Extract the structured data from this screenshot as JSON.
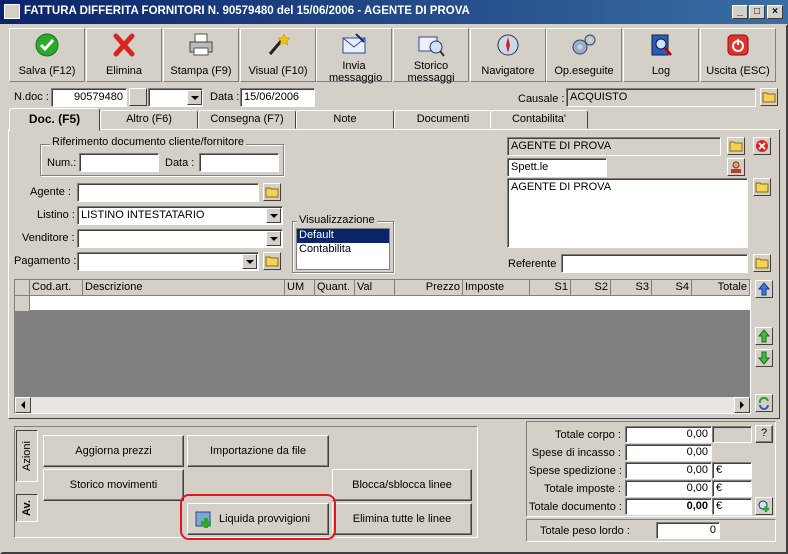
{
  "window": {
    "title": "FATTURA DIFFERITA FORNITORI N. 90579480  del 15/06/2006  - AGENTE DI PROVA",
    "minimize": "_",
    "maximize": "□",
    "close": "×"
  },
  "toolbar": [
    {
      "label": "Salva (F12)",
      "icon": "check-icon"
    },
    {
      "label": "Elimina",
      "icon": "delete-x-icon"
    },
    {
      "label": "Stampa (F9)",
      "icon": "printer-icon"
    },
    {
      "label": "Visual (F10)",
      "icon": "magic-wand-icon"
    },
    {
      "label": "Invia messaggio",
      "icon": "send-mail-icon"
    },
    {
      "label": "Storico messaggi",
      "icon": "mail-history-icon"
    },
    {
      "label": "Navigatore",
      "icon": "compass-icon"
    },
    {
      "label": "Op.eseguite",
      "icon": "gears-icon"
    },
    {
      "label": "Log",
      "icon": "log-book-icon"
    },
    {
      "label": "Uscita (ESC)",
      "icon": "exit-power-icon"
    }
  ],
  "header": {
    "ndoc_label": "N.doc :",
    "ndoc_value": "90579480",
    "data_label": "Data :",
    "data_value": "15/06/2006",
    "causale_label": "Causale :",
    "causale_value": "ACQUISTO"
  },
  "tabs": [
    "Doc. (F5)",
    "Altro (F6)",
    "Consegna (F7)",
    "Note",
    "Documenti",
    "Contabilita'"
  ],
  "doc": {
    "riferimento_title": "Riferimento documento cliente/fornitore",
    "num_label": "Num.:",
    "num_value": "",
    "data_label": "Data :",
    "data_value": "",
    "agente_label": "Agente :",
    "agente_value": "",
    "listino_label": "Listino :",
    "listino_value": "LISTINO INTESTATARIO",
    "venditore_label": "Venditore :",
    "venditore_value": "",
    "pagamento_label": "Pagamento :",
    "pagamento_value": "",
    "visualizzazione_title": "Visualizzazione",
    "visualizzazione_options": [
      "Default",
      "Contabilita"
    ],
    "visualizzazione_selected": "Default",
    "intestatario_name": "AGENTE DI PROVA",
    "intestatario_prefix": "Spett.le",
    "intestatario_address": "AGENTE DI PROVA",
    "referente_label": "Referente",
    "referente_value": ""
  },
  "grid": {
    "columns": [
      "Cod.art.",
      "Descrizione",
      "UM",
      "Quant.",
      "Val",
      "Prezzo",
      "Imposte",
      "S1",
      "S2",
      "S3",
      "S4",
      "Totale"
    ]
  },
  "actions": {
    "tab_azioni": "Azioni",
    "tab_av": "Av.",
    "aggiorna_prezzi": "Aggiorna prezzi",
    "importazione": "Importazione da file",
    "storico_movimenti": "Storico movimenti",
    "blocca": "Blocca/sblocca linee",
    "liquida": "Liquida provvigioni",
    "elimina_linee": "Elimina tutte le linee"
  },
  "totals": {
    "totale_corpo_label": "Totale corpo :",
    "totale_corpo": "0,00",
    "spese_incasso_label": "Spese di incasso :",
    "spese_incasso": "0,00",
    "spese_spedizione_label": "Spese spedizione :",
    "spese_spedizione": "0,00",
    "totale_imposte_label": "Totale imposte :",
    "totale_imposte": "0,00",
    "totale_documento_label": "Totale documento :",
    "totale_documento": "0,00",
    "currency": "€",
    "help": "?",
    "peso_label": "Totale peso lordo :",
    "peso_value": "0"
  },
  "colors": {
    "title_start": "#0a246a",
    "title_end": "#3a6ea5",
    "face": "#d4d0c8",
    "grid_empty": "#808080",
    "highlight_red": "#e0191e",
    "selection": "#0a246a"
  }
}
